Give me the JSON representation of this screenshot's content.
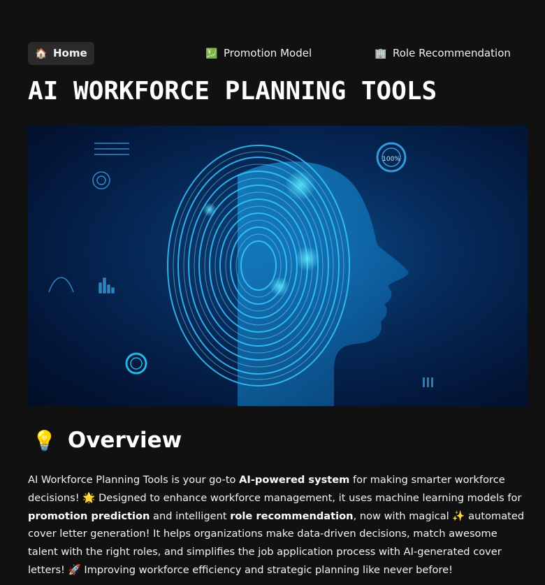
{
  "nav": {
    "home": {
      "icon": "🏠",
      "icon_name": "home-icon",
      "label": "Home"
    },
    "promotion": {
      "icon": "💹",
      "icon_name": "chart-icon",
      "label": "Promotion Model"
    },
    "role": {
      "icon": "🏢",
      "icon_name": "office-building-icon",
      "label": "Role Recommendation"
    }
  },
  "title": "AI WORKFORCE PLANNING TOOLS",
  "hero": {
    "description_name": "ai-fingerprint-face-image",
    "badge": "100%"
  },
  "overview": {
    "icon": "💡",
    "icon_name": "lightbulb-icon",
    "heading": "Overview"
  },
  "description": {
    "p1": "AI Workforce Planning Tools is your go-to ",
    "b1": "AI-powered system",
    "p2": " for making smarter workforce decisions! ",
    "e1": "🌟",
    "p3": " Designed to enhance workforce management, it uses machine learning models for ",
    "b2": "promotion prediction",
    "p4": " and intelligent ",
    "b3": "role recommendation",
    "p5": ", now with magical ",
    "e2": "✨",
    "p6": " automated cover letter generation! It helps organizations make data-driven decisions, match awesome talent with the right roles, and simplifies the job application process with AI-generated cover letters! ",
    "e3": "🚀",
    "p7": " Improving workforce efficiency and strategic planning like never before!"
  },
  "colors": {
    "background": "#111111",
    "accent_glow": "#2fd0ff",
    "hero_dark": "#03173a"
  }
}
